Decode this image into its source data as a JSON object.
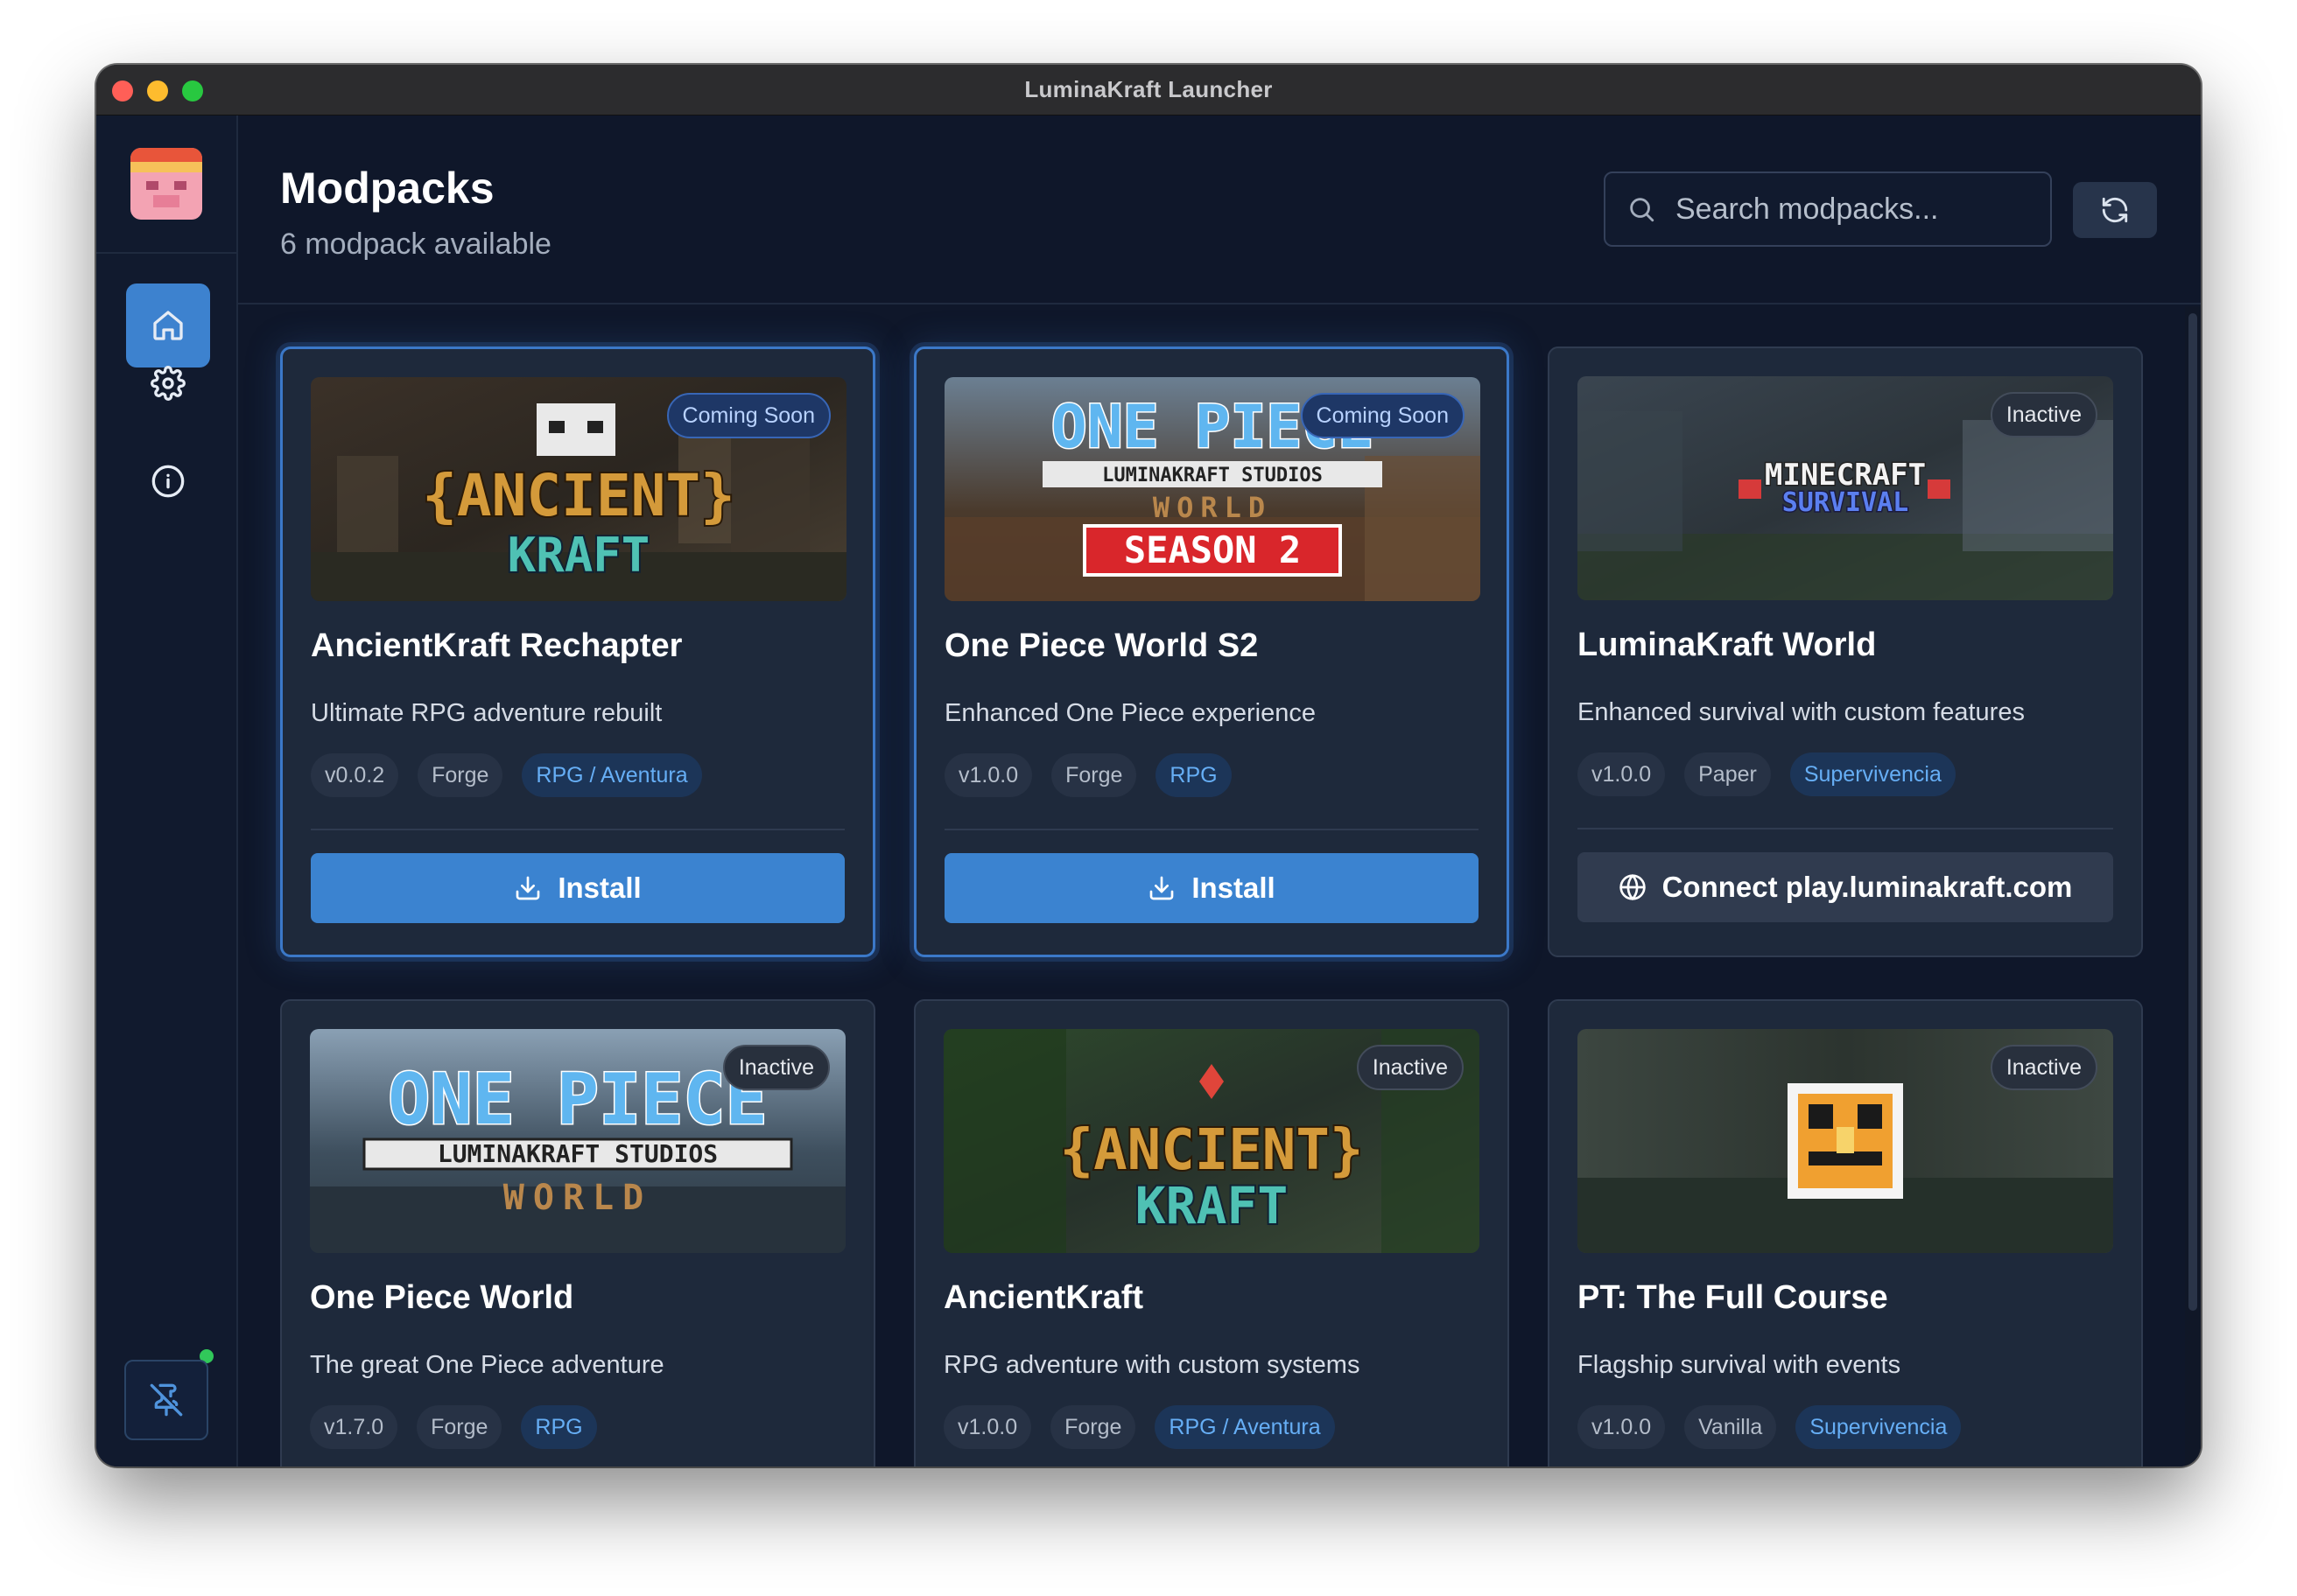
{
  "window": {
    "title": "LuminaKraft Launcher"
  },
  "sidebar": {
    "logo": "pixel-pig-logo",
    "items": [
      {
        "name": "home",
        "icon": "home-icon",
        "active": true
      },
      {
        "name": "settings",
        "icon": "gear-icon",
        "active": false
      },
      {
        "name": "about",
        "icon": "info-icon",
        "active": false
      }
    ],
    "pin_icon": "pin-off-icon",
    "status_color": "#31c85a"
  },
  "header": {
    "title": "Modpacks",
    "subtitle": "6 modpack available",
    "search_placeholder": "Search modpacks...",
    "refresh_icon": "refresh-icon"
  },
  "colors": {
    "accent": "#3b83d0",
    "background": "#0f172a",
    "card": "#1e293b"
  },
  "modpacks": [
    {
      "title": "AncientKraft Rechapter",
      "description": "Ultimate RPG adventure rebuilt",
      "badge": "Coming Soon",
      "version": "v0.0.2",
      "loader": "Forge",
      "category": "RPG / Aventura",
      "banner_line1": "{ANCIENT}",
      "banner_line2": "KRAFT",
      "action": "Install"
    },
    {
      "title": "One Piece World S2",
      "description": "Enhanced One Piece experience",
      "badge": "Coming Soon",
      "version": "v1.0.0",
      "loader": "Forge",
      "category": "RPG",
      "banner_line1": "ONE PIECE",
      "banner_line2": "LUMINAKRAFT STUDIOS",
      "banner_line3": "WORLD",
      "banner_line4": "SEASON 2",
      "action": "Install"
    },
    {
      "title": "LuminaKraft World",
      "description": "Enhanced survival with custom features",
      "badge": "Inactive",
      "version": "v1.0.0",
      "loader": "Paper",
      "category": "Supervivencia",
      "banner_line1": "MINECRAFT",
      "banner_line2": "SURVIVAL",
      "action": "Connect play.luminakraft.com"
    },
    {
      "title": "One Piece World",
      "description": "The great One Piece adventure",
      "badge": "Inactive",
      "version": "v1.7.0",
      "loader": "Forge",
      "category": "RPG",
      "banner_line1": "ONE PIECE",
      "banner_line2": "LUMINAKRAFT STUDIOS",
      "banner_line3": "WORLD"
    },
    {
      "title": "AncientKraft",
      "description": "RPG adventure with custom systems",
      "badge": "Inactive",
      "version": "v1.0.0",
      "loader": "Forge",
      "category": "RPG / Aventura",
      "banner_line1": "{ANCIENT}",
      "banner_line2": "KRAFT"
    },
    {
      "title": "PT: The Full Course",
      "description": "Flagship survival with events",
      "badge": "Inactive",
      "version": "v1.0.0",
      "loader": "Vanilla",
      "category": "Supervivencia"
    }
  ]
}
